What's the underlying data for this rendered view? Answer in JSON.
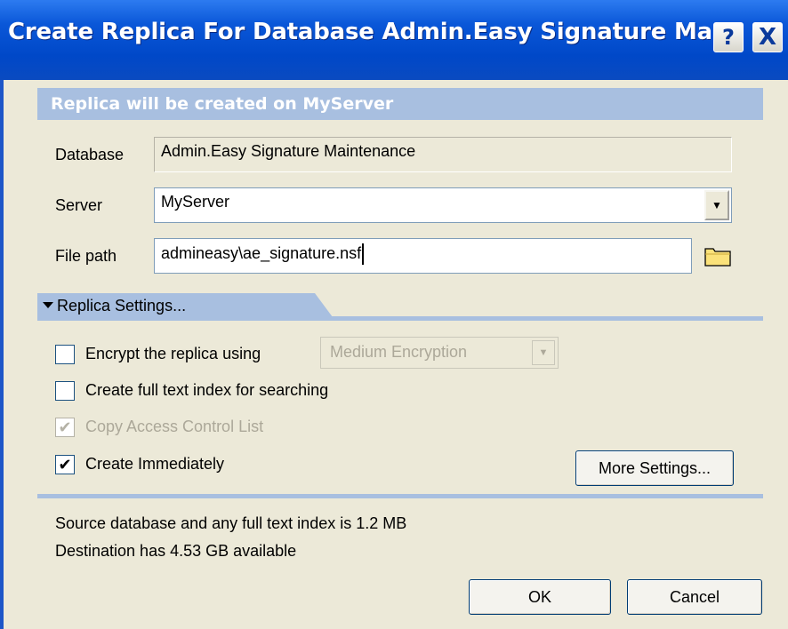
{
  "window": {
    "title": "Create Replica For Database Admin.Easy Signature Maintenanc",
    "help_label": "?",
    "close_label": "X"
  },
  "banner": {
    "text": "Replica will be created on MyServer"
  },
  "form": {
    "database_label": "Database",
    "database_value": "Admin.Easy Signature Maintenance",
    "server_label": "Server",
    "server_value": "MyServer",
    "filepath_label": "File path",
    "filepath_value": "admineasy\\ae_signature.nsf"
  },
  "replica_settings": {
    "section_label": "Replica Settings...",
    "encrypt": {
      "label": "Encrypt the replica using",
      "checked": false,
      "enabled": true
    },
    "encryption_level": {
      "value": "Medium Encryption",
      "enabled": false
    },
    "fulltext": {
      "label": "Create full text index for searching",
      "checked": false,
      "enabled": true
    },
    "copy_acl": {
      "label": "Copy Access Control List",
      "checked": true,
      "enabled": false
    },
    "create_immediately": {
      "label": "Create Immediately",
      "checked": true,
      "enabled": true
    },
    "more_settings_label": "More Settings..."
  },
  "info": {
    "source_size": "Source database and any full text index is 1.2 MB",
    "destination_available": "Destination has 4.53 GB available"
  },
  "buttons": {
    "ok": "OK",
    "cancel": "Cancel"
  },
  "colors": {
    "titlebar": "#0a57d8",
    "banner": "#a8bfe0",
    "dialog_bg": "#ece9d8"
  }
}
